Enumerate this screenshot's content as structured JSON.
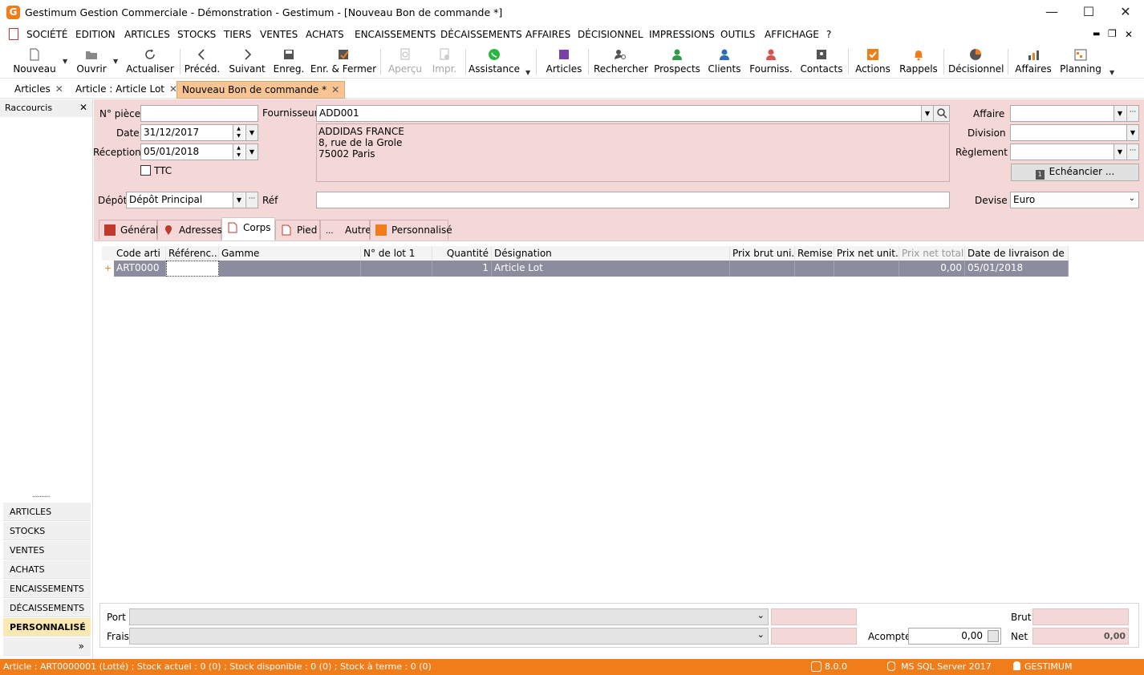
{
  "window": {
    "app_icon_letter": "G",
    "title": "Gestimum Gestion Commerciale - Démonstration - Gestimum - [Nouveau Bon de commande *]",
    "min_symbol": "—",
    "max_symbol": "☐",
    "close_symbol": "✕"
  },
  "menu": {
    "items": [
      "SOCIÉTÉ",
      "EDITION",
      "ARTICLES",
      "STOCKS",
      "TIERS",
      "VENTES",
      "ACHATS",
      "ENCAISSEMENTS",
      "DÉCAISSEMENTS",
      "AFFAIRES",
      "DÉCISIONNEL",
      "IMPRESSIONS",
      "OUTILS",
      "AFFICHAGE",
      "?"
    ],
    "mdi_min": "▬",
    "mdi_restore": "❐",
    "mdi_close": "✕"
  },
  "toolbar": {
    "buttons": [
      {
        "label": "Nouveau",
        "icon": "new-document-icon"
      },
      {
        "label": "Ouvrir",
        "icon": "folder-open-icon"
      },
      {
        "label": "Actualiser",
        "icon": "refresh-icon"
      },
      {
        "label": "Précéd.",
        "icon": "chevron-left-icon"
      },
      {
        "label": "Suivant",
        "icon": "chevron-right-icon"
      },
      {
        "label": "Enreg.",
        "icon": "floppy-disk-icon"
      },
      {
        "label": "Enr. & Fermer",
        "icon": "save-close-icon"
      },
      {
        "label": "Aperçu",
        "icon": "preview-icon"
      },
      {
        "label": "Impr.",
        "icon": "print-icon"
      },
      {
        "label": "Assistance",
        "icon": "whatsapp-icon"
      },
      {
        "label": "Articles",
        "icon": "article-square-icon"
      },
      {
        "label": "Rechercher",
        "icon": "search-user-icon"
      },
      {
        "label": "Prospects",
        "icon": "prospect-user-icon"
      },
      {
        "label": "Clients",
        "icon": "client-user-icon"
      },
      {
        "label": "Fourniss.",
        "icon": "supplier-user-icon"
      },
      {
        "label": "Contacts",
        "icon": "contact-card-icon"
      },
      {
        "label": "Actions",
        "icon": "checkbox-icon"
      },
      {
        "label": "Rappels",
        "icon": "bell-icon"
      },
      {
        "label": "Décisionnel",
        "icon": "pie-chart-icon"
      },
      {
        "label": "Affaires",
        "icon": "bar-chart-icon"
      },
      {
        "label": "Planning",
        "icon": "calendar-grid-icon"
      }
    ]
  },
  "doc_tabs": [
    {
      "label": "Articles",
      "close": "✕"
    },
    {
      "label": "Article : Article Lot",
      "close": "✕"
    },
    {
      "label": "Nouveau Bon de commande *",
      "close": "✕"
    }
  ],
  "left_panel": {
    "header": "Raccourcis",
    "close": "✕",
    "grip": "..........",
    "items": [
      "ARTICLES",
      "STOCKS",
      "VENTES",
      "ACHATS",
      "ENCAISSEMENTS",
      "DÉCAISSEMENTS",
      "PERSONNALISÉ"
    ],
    "more": "»"
  },
  "form": {
    "npiece_label": "N° pièce",
    "npiece_value": "",
    "date_label": "Date",
    "date_value": "31/12/2017",
    "reception_label": "Réception",
    "reception_value": "05/01/2018",
    "ttc_label": "TTC",
    "fournisseur_label": "Fournisseur",
    "fournisseur_value": "ADD001",
    "address_lines": [
      "ADDIDAS FRANCE",
      "8, rue de la Grole",
      "75002 Paris"
    ],
    "affaire_label": "Affaire",
    "affaire_value": "",
    "division_label": "Division",
    "division_value": "",
    "reglement_label": "Règlement",
    "reglement_value": "",
    "echeancier_label": "Echéancier ...",
    "depot_label": "Dépôt",
    "depot_value": "Dépôt Principal",
    "ref_label": "Réf",
    "ref_value": "",
    "devise_label": "Devise",
    "devise_value": "Euro"
  },
  "inner_tabs": [
    "Général",
    "Adresses",
    "Corps",
    "Pied",
    "Autre",
    "Personnalisé"
  ],
  "grid": {
    "columns": [
      "Code arti",
      "Référenc...",
      "Gamme",
      "N° de lot 1",
      "Quantité",
      "Désignation",
      "Prix brut uni...",
      "Remise",
      "Prix net unit...",
      "Prix net total",
      "Date de livraison de l..."
    ],
    "row_marker": "+",
    "rows": [
      [
        "ART0000",
        "",
        "",
        "",
        "1",
        "Article Lot",
        "",
        "",
        "",
        "0,00",
        "05/01/2018"
      ]
    ]
  },
  "bottom": {
    "port_label": "Port",
    "frais_label": "Frais",
    "acompte_label": "Acompte",
    "acompte_value": "0,00",
    "brut_label": "Brut",
    "brut_value": "",
    "net_label": "Net",
    "net_value": "0,00"
  },
  "status": {
    "article_info": "Article : ART0000001 (Lotté) ; Stock actuel : 0 (0) ; Stock disponible : 0 (0) ; Stock à terme : 0 (0)",
    "version": "8.0.0",
    "db": "MS SQL Server 2017",
    "user": "GESTIMUM"
  },
  "colors": {
    "accent": "#f07d1a",
    "form_bg": "#f4d7d7",
    "selected_row": "#8c8c9e",
    "active_tab": "#f8c493"
  }
}
